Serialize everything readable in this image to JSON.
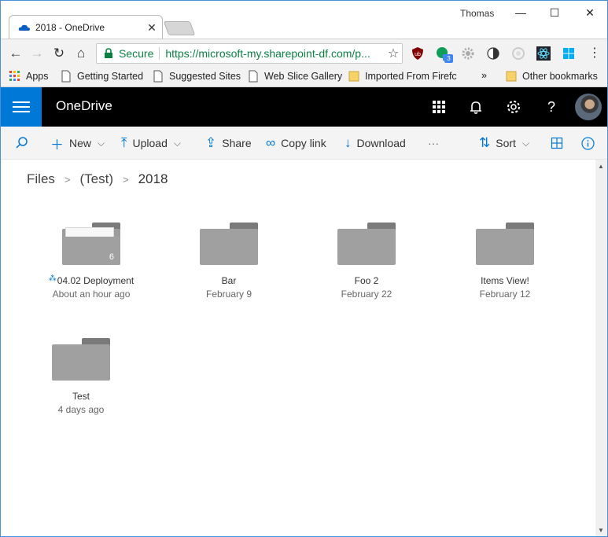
{
  "browser": {
    "tab_title": "2018 - OneDrive",
    "user_name": "Thomas",
    "secure_label": "Secure",
    "url": "https://microsoft-my.sharepoint-df.com/p...",
    "window_buttons": {
      "minimize": "—",
      "maximize": "☐",
      "close": "✕"
    }
  },
  "bookmarks": {
    "items": [
      "Apps",
      "Getting Started",
      "Suggested Sites",
      "Web Slice Gallery",
      "Imported From Firefc"
    ],
    "overflow": "»",
    "other": "Other bookmarks"
  },
  "extensions": [
    "ublock-icon",
    "hangouts-icon",
    "gear-icon",
    "contrast-icon",
    "circle-icon",
    "react-icon",
    "windows-icon"
  ],
  "extension_badge": "3",
  "header": {
    "brand": "OneDrive",
    "accent": "#0078d7"
  },
  "commands": {
    "new": "New",
    "upload": "Upload",
    "share": "Share",
    "copy_link": "Copy link",
    "download": "Download",
    "more": "···",
    "sort": "Sort"
  },
  "breadcrumb": [
    "Files",
    "(Test)",
    "2018"
  ],
  "folders": [
    {
      "name": "04.02 Deployment",
      "date": "About an hour ago",
      "count": "6",
      "is_new": true
    },
    {
      "name": "Bar",
      "date": "February 9"
    },
    {
      "name": "Foo 2",
      "date": "February 22"
    },
    {
      "name": "Items View!",
      "date": "February 12"
    },
    {
      "name": "Test",
      "date": "4 days ago"
    }
  ]
}
